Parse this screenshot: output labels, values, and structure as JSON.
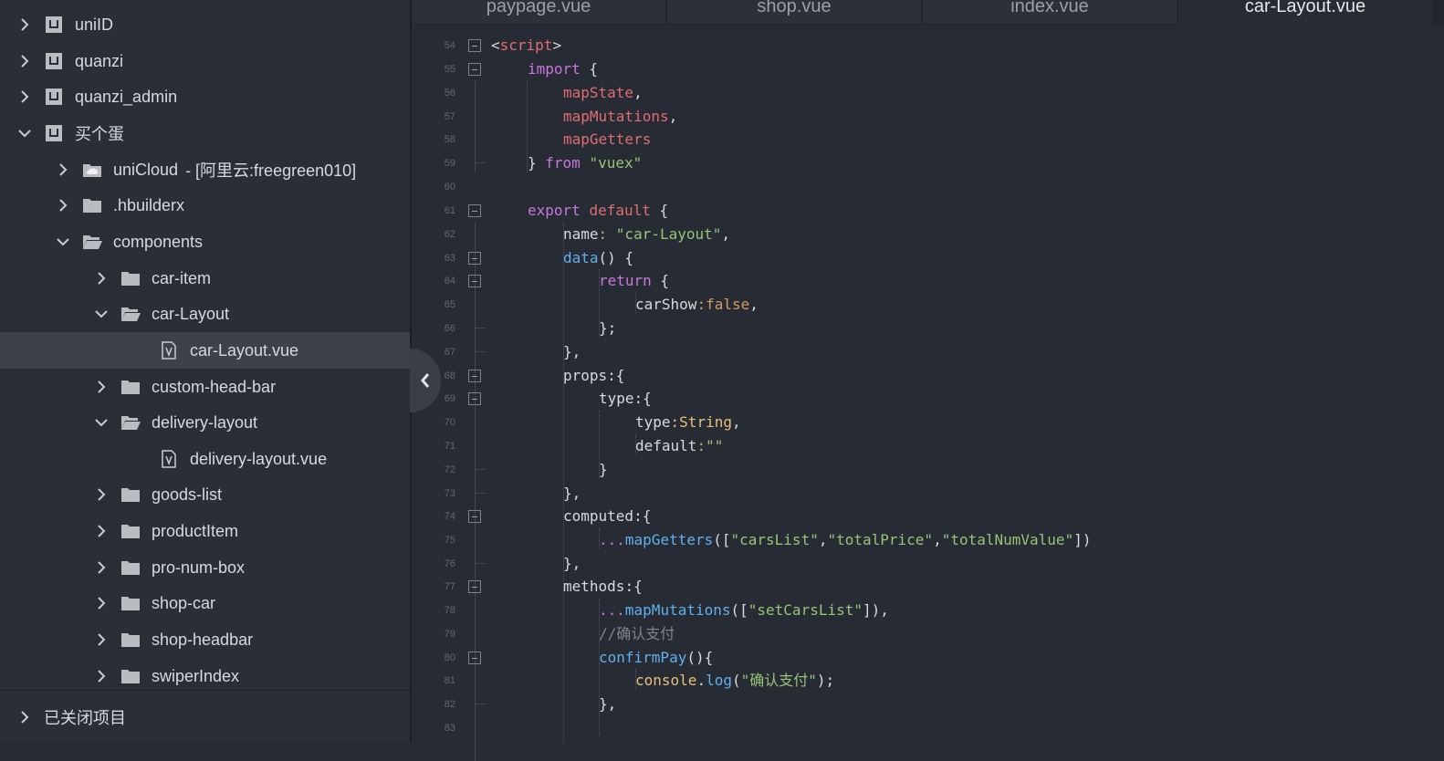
{
  "sidebar": {
    "projects": [
      {
        "label": "uniID",
        "expanded": false,
        "icon": "project-icon"
      },
      {
        "label": "quanzi",
        "expanded": false,
        "icon": "project-icon"
      },
      {
        "label": "quanzi_admin",
        "expanded": false,
        "icon": "project-icon"
      },
      {
        "label": "买个蛋",
        "expanded": true,
        "icon": "project-icon"
      }
    ],
    "tree": [
      {
        "label": "uniCloud",
        "sub": "- [阿里云:freegreen010]",
        "icon": "cloud-folder-icon"
      },
      {
        "label": ".hbuilderx",
        "icon": "folder-icon"
      },
      {
        "label": "components",
        "icon": "folder-open-icon"
      },
      {
        "label": "car-item",
        "icon": "folder-icon"
      },
      {
        "label": "car-Layout",
        "icon": "folder-open-icon"
      },
      {
        "label": "car-Layout.vue",
        "icon": "vue-file-icon",
        "selected": true
      },
      {
        "label": "custom-head-bar",
        "icon": "folder-icon"
      },
      {
        "label": "delivery-layout",
        "icon": "folder-open-icon"
      },
      {
        "label": "delivery-layout.vue",
        "icon": "vue-file-icon"
      },
      {
        "label": "goods-list",
        "icon": "folder-icon"
      },
      {
        "label": "productItem",
        "icon": "folder-icon"
      },
      {
        "label": "pro-num-box",
        "icon": "folder-icon"
      },
      {
        "label": "shop-car",
        "icon": "folder-icon"
      },
      {
        "label": "shop-headbar",
        "icon": "folder-icon"
      },
      {
        "label": "swiperIndex",
        "icon": "folder-icon"
      }
    ],
    "closed_projects_label": "已关闭项目"
  },
  "tabs": [
    {
      "label": "paypage.vue",
      "active": false
    },
    {
      "label": "shop.vue",
      "active": false
    },
    {
      "label": "index.vue",
      "active": false
    },
    {
      "label": "car-Layout.vue",
      "active": true
    }
  ],
  "editor": {
    "lines": [
      {
        "n": "54",
        "fold": true
      },
      {
        "n": "55",
        "fold": true
      },
      {
        "n": "56"
      },
      {
        "n": "57"
      },
      {
        "n": "58"
      },
      {
        "n": "59"
      },
      {
        "n": "60"
      },
      {
        "n": "61",
        "fold": true
      },
      {
        "n": "62"
      },
      {
        "n": "63",
        "fold": true
      },
      {
        "n": "64",
        "fold": true
      },
      {
        "n": "65"
      },
      {
        "n": "66"
      },
      {
        "n": "67"
      },
      {
        "n": "68",
        "fold": true
      },
      {
        "n": "69",
        "fold": true
      },
      {
        "n": "70"
      },
      {
        "n": "71"
      },
      {
        "n": "72"
      },
      {
        "n": "73"
      },
      {
        "n": "74",
        "fold": true
      },
      {
        "n": "75"
      },
      {
        "n": "76"
      },
      {
        "n": "77",
        "fold": true
      },
      {
        "n": "78"
      },
      {
        "n": "79"
      },
      {
        "n": "80",
        "fold": true
      },
      {
        "n": "81"
      },
      {
        "n": "82"
      },
      {
        "n": "83"
      }
    ],
    "code": {
      "l54": [
        "<",
        "script",
        ">"
      ],
      "l55": [
        "import",
        " {"
      ],
      "l56": [
        "mapState",
        ","
      ],
      "l57": [
        "mapMutations",
        ","
      ],
      "l58": [
        "mapGetters"
      ],
      "l59": [
        "} ",
        "from",
        " ",
        "\"vuex\""
      ],
      "l61": [
        "export",
        " ",
        "default",
        " {"
      ],
      "l62": [
        "name",
        ": ",
        "\"car-Layout\"",
        ","
      ],
      "l63": [
        "data",
        "() {"
      ],
      "l64": [
        "return",
        " {"
      ],
      "l65": [
        "carShow",
        ":",
        "false",
        ","
      ],
      "l66": [
        "};"
      ],
      "l67": [
        "},"
      ],
      "l68": [
        "props",
        ":{"
      ],
      "l69": [
        "type",
        ":{"
      ],
      "l70": [
        "type",
        ":",
        "String",
        ","
      ],
      "l71": [
        "default",
        ":",
        "\"\""
      ],
      "l72": [
        "}"
      ],
      "l73": [
        "},"
      ],
      "l74": [
        "computed",
        ":{"
      ],
      "l75": [
        "...",
        "mapGetters",
        "([",
        "\"carsList\"",
        ",",
        "\"totalPrice\"",
        ",",
        "\"totalNumValue\"",
        "])"
      ],
      "l76": [
        "},"
      ],
      "l77": [
        "methods",
        ":{"
      ],
      "l78": [
        "...",
        "mapMutations",
        "([",
        "\"setCarsList\"",
        "]),"
      ],
      "l79": [
        "//确认支付"
      ],
      "l80": [
        "confirmPay",
        "(){"
      ],
      "l81": [
        "console",
        ".",
        "log",
        "(",
        "\"确认支付\"",
        ");"
      ],
      "l82": [
        "},"
      ]
    }
  }
}
